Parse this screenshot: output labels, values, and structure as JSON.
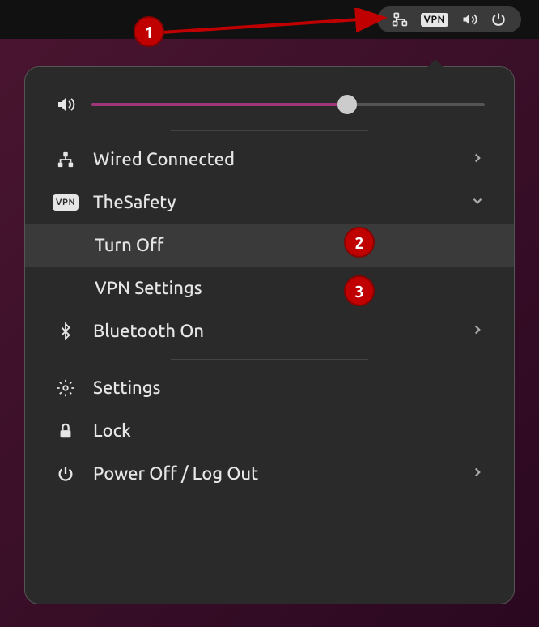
{
  "topbar": {
    "vpn_badge": "VPN"
  },
  "volume": {
    "level_percent": 65
  },
  "menu": {
    "wired": {
      "label": "Wired Connected"
    },
    "vpn": {
      "label": "TheSafety",
      "badge": "VPN",
      "turn_off": "Turn Off",
      "settings": "VPN Settings"
    },
    "bluetooth": {
      "label": "Bluetooth On"
    },
    "settings": {
      "label": "Settings"
    },
    "lock": {
      "label": "Lock"
    },
    "power": {
      "label": "Power Off / Log Out"
    }
  },
  "annotations": {
    "one": "1",
    "two": "2",
    "three": "3"
  }
}
